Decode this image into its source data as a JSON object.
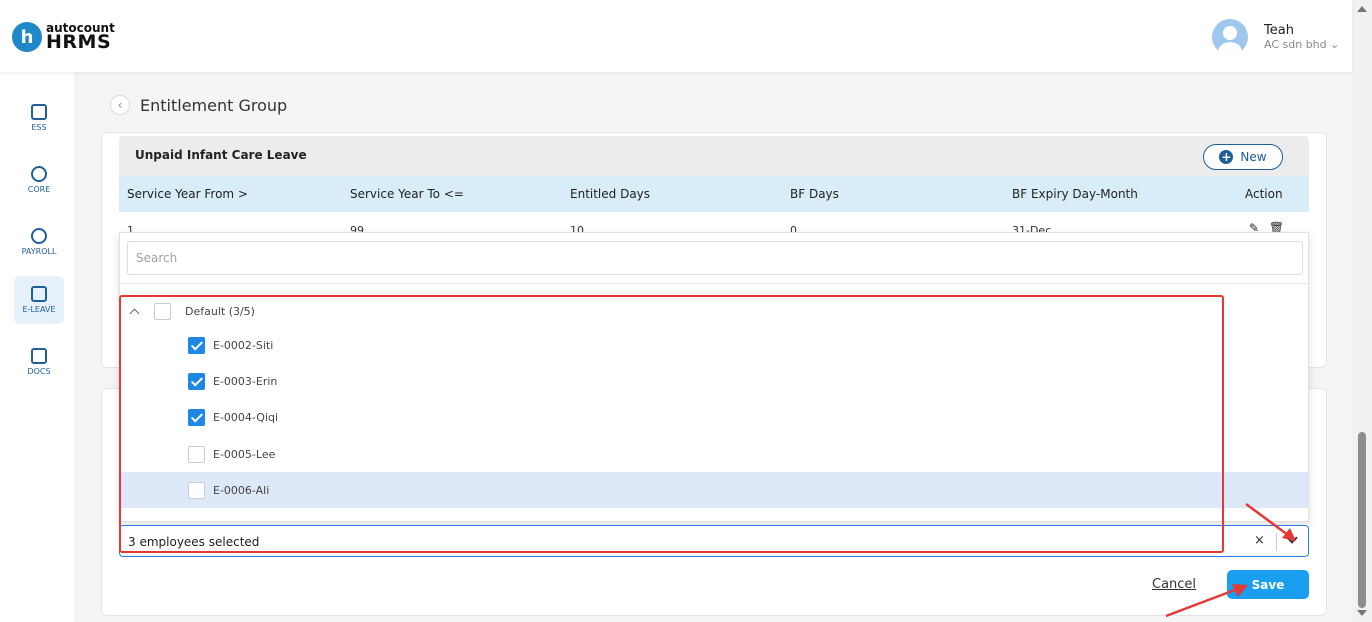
{
  "app": {
    "logo_small": "autocount",
    "logo_big": "HRMS",
    "logo_letter": "h"
  },
  "user": {
    "name": "Teah",
    "company": "AC sdn bhd"
  },
  "sidebar": {
    "items": [
      {
        "label": "ESS",
        "icon": "profile-icon"
      },
      {
        "label": "CORE",
        "icon": "cube-icon"
      },
      {
        "label": "PAYROLL",
        "icon": "dollar-icon"
      },
      {
        "label": "E-LEAVE",
        "icon": "calendar-icon"
      },
      {
        "label": "DOCS",
        "icon": "document-icon"
      }
    ]
  },
  "page": {
    "title": "Entitlement Group"
  },
  "group": {
    "name": "Unpaid Infant Care Leave",
    "new_label": "New",
    "columns": [
      "Service Year From >",
      "Service Year To <=",
      "Entitled Days",
      "BF Days",
      "BF Expiry Day-Month",
      "Action"
    ],
    "rows": [
      [
        "1",
        "99",
        "10",
        "0",
        "31-Dec"
      ]
    ]
  },
  "dropdown": {
    "search_placeholder": "Search",
    "group_label": "Default (3/5)",
    "employees": [
      {
        "label": "E-0002-Siti",
        "checked": true
      },
      {
        "label": "E-0003-Erin",
        "checked": true
      },
      {
        "label": "E-0004-Qiqi",
        "checked": true
      },
      {
        "label": "E-0005-Lee",
        "checked": false
      },
      {
        "label": "E-0006-Ali",
        "checked": false
      }
    ]
  },
  "select": {
    "value": "3 employees selected",
    "clear": "×"
  },
  "actions": {
    "cancel": "Cancel",
    "save": "Save"
  },
  "colors": {
    "primary": "#1e5f9c",
    "accent": "#1a9ef0",
    "annotation": "#e53935"
  }
}
